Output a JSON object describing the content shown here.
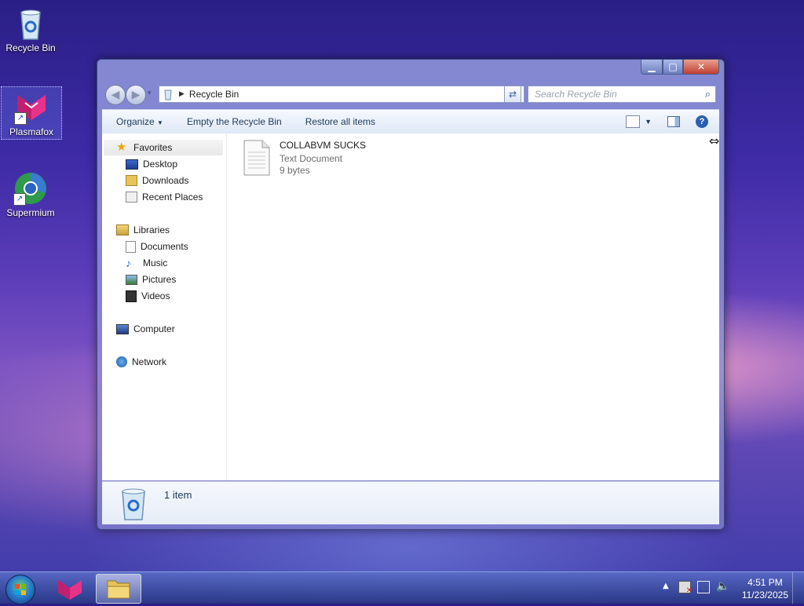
{
  "desktop": {
    "icons": [
      {
        "label": "Recycle Bin",
        "icon": "recycle-bin-icon"
      },
      {
        "label": "Plasmafox",
        "icon": "plasmafox-icon"
      },
      {
        "label": "Supermium",
        "icon": "supermium-icon"
      }
    ]
  },
  "window": {
    "address": "Recycle Bin",
    "search_placeholder": "Search Recycle Bin",
    "toolbar": {
      "organize": "Organize",
      "empty": "Empty the Recycle Bin",
      "restore": "Restore all items"
    },
    "nav": {
      "favorites": "Favorites",
      "desktop": "Desktop",
      "downloads": "Downloads",
      "recent_places": "Recent Places",
      "libraries": "Libraries",
      "documents": "Documents",
      "music": "Music",
      "pictures": "Pictures",
      "videos": "Videos",
      "computer": "Computer",
      "network": "Network"
    },
    "files": [
      {
        "name": "COLLABVM SUCKS",
        "type": "Text Document",
        "size": "9 bytes"
      }
    ],
    "details": {
      "count": "1 item"
    }
  },
  "taskbar": {
    "time": "4:51 PM",
    "date": "11/23/2025"
  },
  "colors": {
    "link_text": "#1e395b",
    "selection": "#c8c8ff"
  }
}
